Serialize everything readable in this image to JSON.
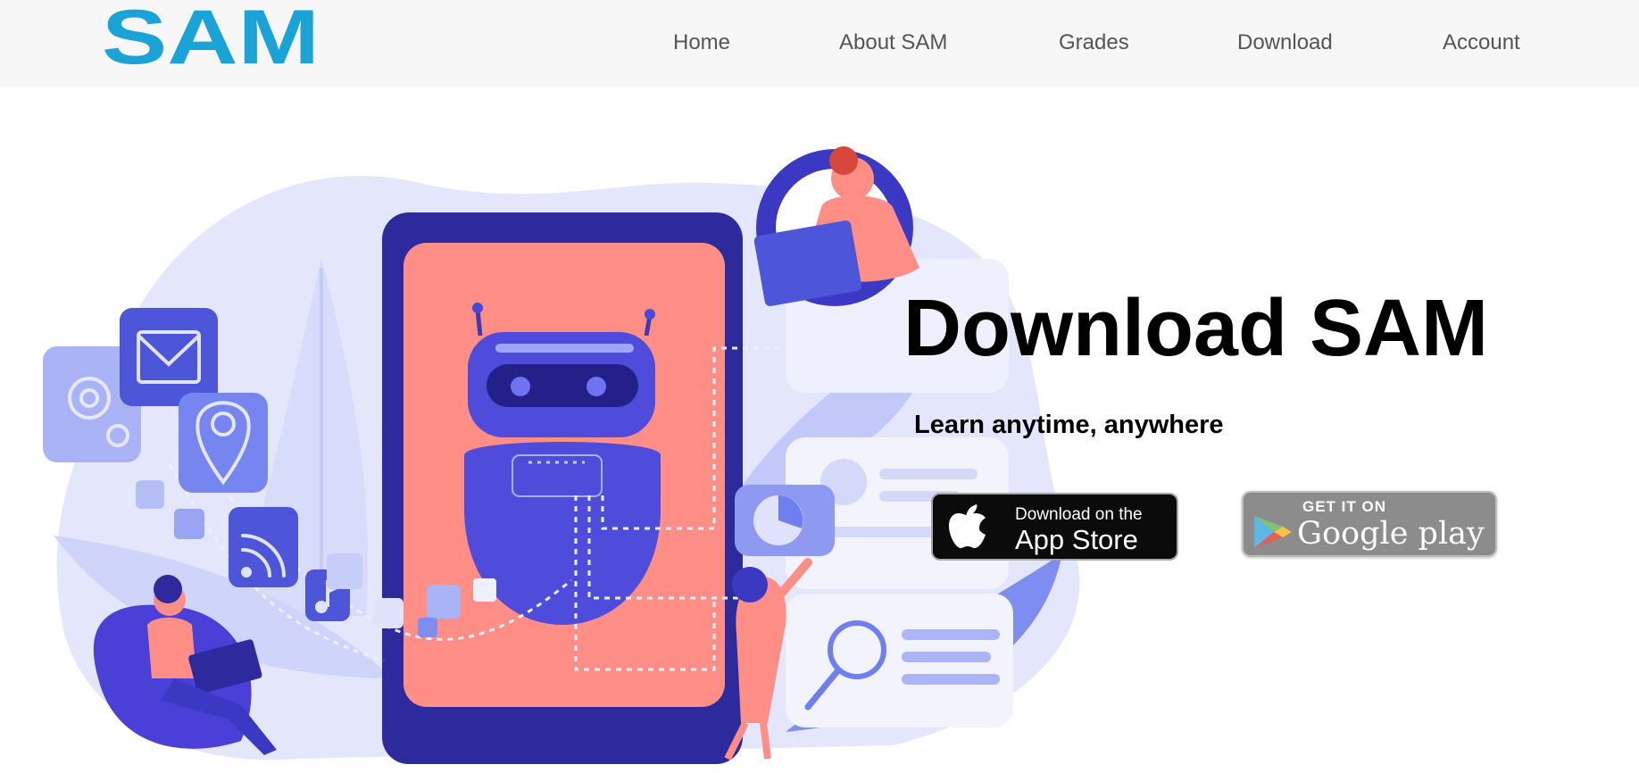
{
  "header": {
    "logo_text": "SAM",
    "nav": [
      {
        "label": "Home"
      },
      {
        "label": "About SAM"
      },
      {
        "label": "Grades"
      },
      {
        "label": "Download"
      },
      {
        "label": "Account"
      }
    ]
  },
  "hero": {
    "title": "Download SAM",
    "subtitle": "Learn anytime, anywhere",
    "app_store": {
      "small": "Download on the",
      "big": "App Store"
    },
    "google_play": {
      "small": "GET IT ON",
      "big": "Google play"
    }
  },
  "colors": {
    "logo": "#1aa3d6",
    "nav_text": "#555555",
    "navbar_bg": "#f7f7f7",
    "illustration_indigo": "#3f3fd6",
    "illustration_coral": "#ff8f86",
    "illustration_lavender": "#dfe3fb"
  },
  "icons": [
    "apple-icon",
    "google-play-icon",
    "envelope-icon",
    "gear-icon",
    "location-pin-icon",
    "wifi-icon",
    "music-note-icon",
    "pie-chart-icon",
    "magnifier-icon",
    "robot-illustration"
  ]
}
